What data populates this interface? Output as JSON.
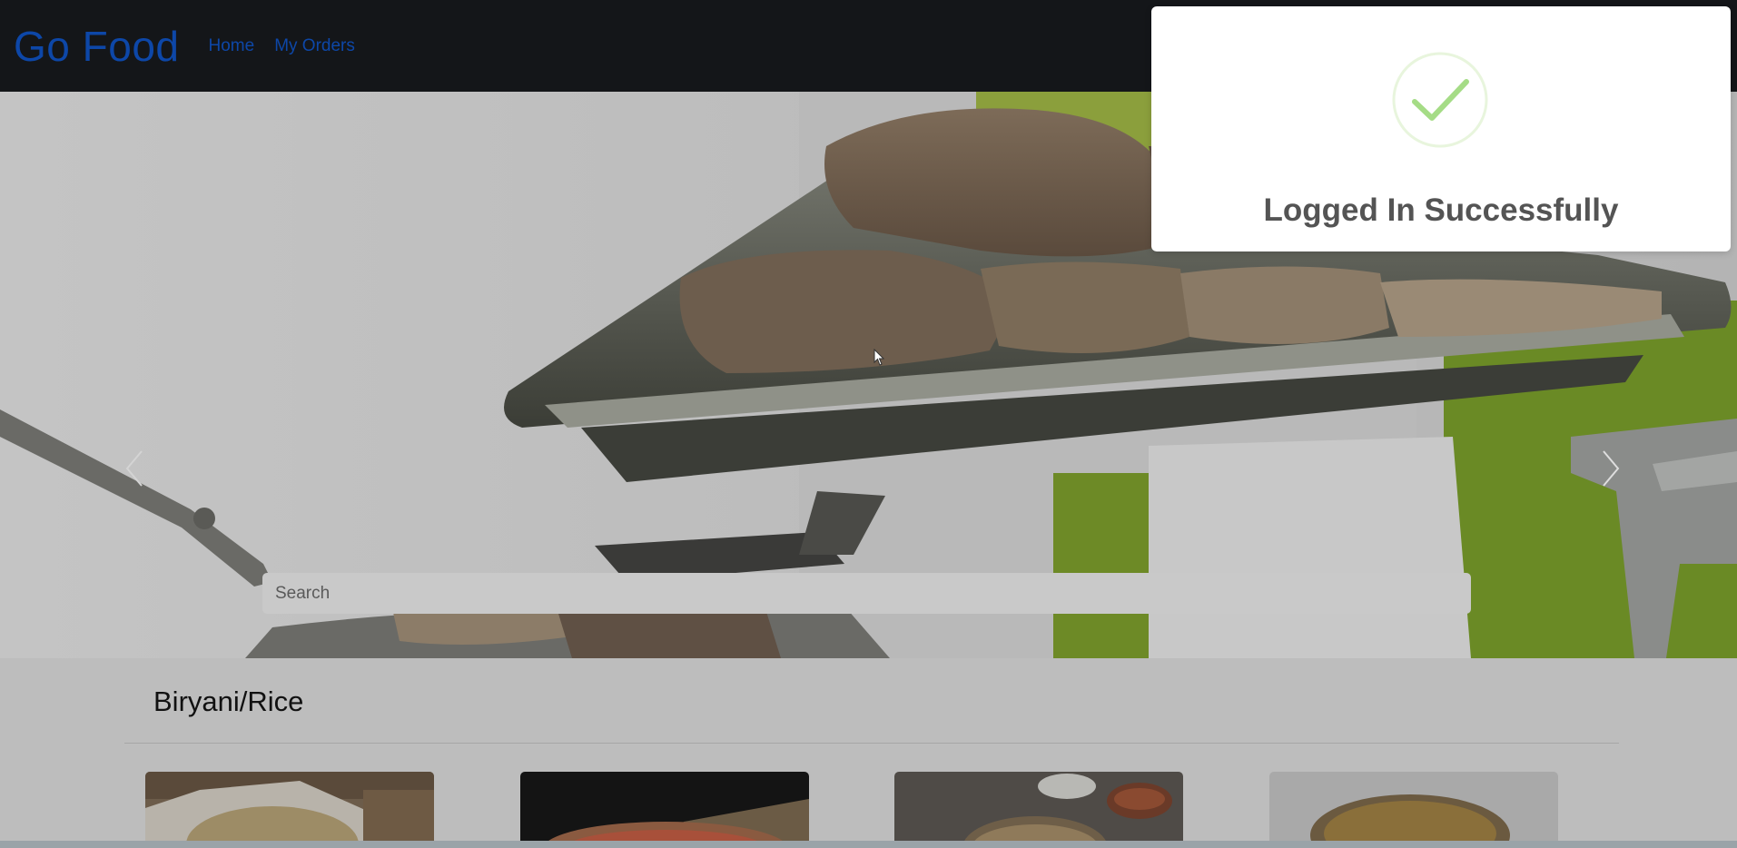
{
  "navbar": {
    "brand": "Go Food",
    "links": [
      "Home",
      "My Orders"
    ]
  },
  "search": {
    "placeholder": "Search",
    "value": ""
  },
  "category": {
    "title": "Biryani/Rice",
    "cards_visible": 4
  },
  "toast": {
    "title": "Logged In Successfully",
    "icon": "check-icon",
    "status_color": "#a5dc86"
  },
  "colors": {
    "navbar_bg": "#141619",
    "link": "#0d47a8",
    "backdrop": "#bdbdbd"
  }
}
